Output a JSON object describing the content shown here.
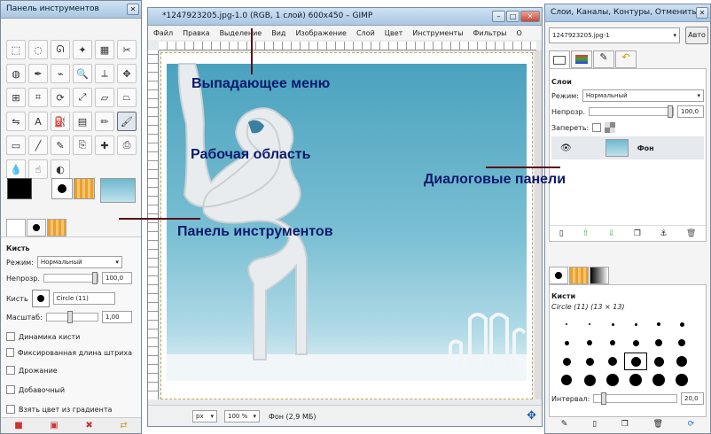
{
  "toolbox": {
    "title": "Панель инструментов",
    "tools": [
      "rect-select-icon",
      "ellipse-select-icon",
      "lasso-icon",
      "fuzzy-select-icon",
      "color-select-icon",
      "scissors-icon",
      "foreground-select-icon",
      "paths-icon",
      "color-picker-icon",
      "zoom-icon",
      "measure-icon",
      "move-icon",
      "align-icon",
      "crop-icon",
      "rotate-icon",
      "scale-icon",
      "shear-icon",
      "perspective-icon",
      "flip-icon",
      "text-icon",
      "bucket-fill-icon",
      "blend-icon",
      "pencil-icon",
      "paintbrush-icon",
      "eraser-icon",
      "airbrush-icon",
      "ink-icon",
      "clone-icon",
      "heal-icon",
      "perspective-clone-icon",
      "blur-icon",
      "smudge-icon",
      "dodge-burn-icon"
    ],
    "brush_options": {
      "title": "Кисть",
      "mode_label": "Режим:",
      "mode_value": "Нормальный",
      "opacity_label": "Непрозр.",
      "opacity_value": "100,0",
      "brush_label": "Кисть",
      "brush_value": "Circle (11)",
      "scale_label": "Масштаб:",
      "scale_value": "1,00",
      "brush_dynamics": "Динамика кисти",
      "fade_length": "Фиксированная длина штриха",
      "jitter": "Дрожание",
      "incremental": "Добавочный",
      "gradient": "Взять цвет из градиента"
    }
  },
  "image_window": {
    "title": "*1247923205.jpg-1.0 (RGB, 1 слой) 600x450 – GIMP",
    "menu": [
      "Файл",
      "Правка",
      "Выделение",
      "Вид",
      "Изображение",
      "Слой",
      "Цвет",
      "Инструменты",
      "Фильтры",
      "О"
    ],
    "status": {
      "unit": "px",
      "zoom": "100 %",
      "info": "Фон (2,9 МБ)"
    }
  },
  "dock": {
    "title": "Слои, Каналы, Контуры, Отменить",
    "image_select": "1247923205.jpg-1",
    "auto_button": "Авто",
    "layers_title": "Слои",
    "mode_label": "Режим:",
    "mode_value": "Нормальный",
    "opacity_label": "Непрозр.",
    "opacity_value": "100,0",
    "lock_label": "Запереть:",
    "layer_name": "Фон",
    "brushes_title": "Кисти",
    "brush_name": "Circle (11) (13 × 13)",
    "spacing_label": "Интервал:",
    "spacing_value": "20,0"
  },
  "annotations": {
    "menu": "Выпадающее меню",
    "canvas": "Рабочая область",
    "docks": "Диалоговые панели",
    "toolbox": "Панель инструментов"
  },
  "colors": {
    "sky_top": "#4da7c2",
    "sky_bottom": "#a8d7e4",
    "annotation": "#0c1a6c",
    "pointer": "#5a0f1a"
  }
}
